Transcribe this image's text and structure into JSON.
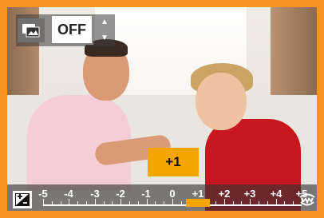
{
  "photo_overlay": {
    "setting_value": "OFF",
    "exposure_badge": "+1",
    "exposure_compensation_value": 1
  },
  "exposure_scale": {
    "labels": [
      "-5",
      "-4",
      "-3",
      "-2",
      "-1",
      "0",
      "+1",
      "+2",
      "+3",
      "+4",
      "+5"
    ],
    "min": -5,
    "max": 5,
    "selected_value": 1
  },
  "icons": {
    "setting_icon": "bracket-mode-icon",
    "ev_icon": "exposure-compensation-icon",
    "wheel_icon": "control-dial-icon"
  },
  "colors": {
    "frame": "#f7941d",
    "accent": "#f7a600"
  }
}
